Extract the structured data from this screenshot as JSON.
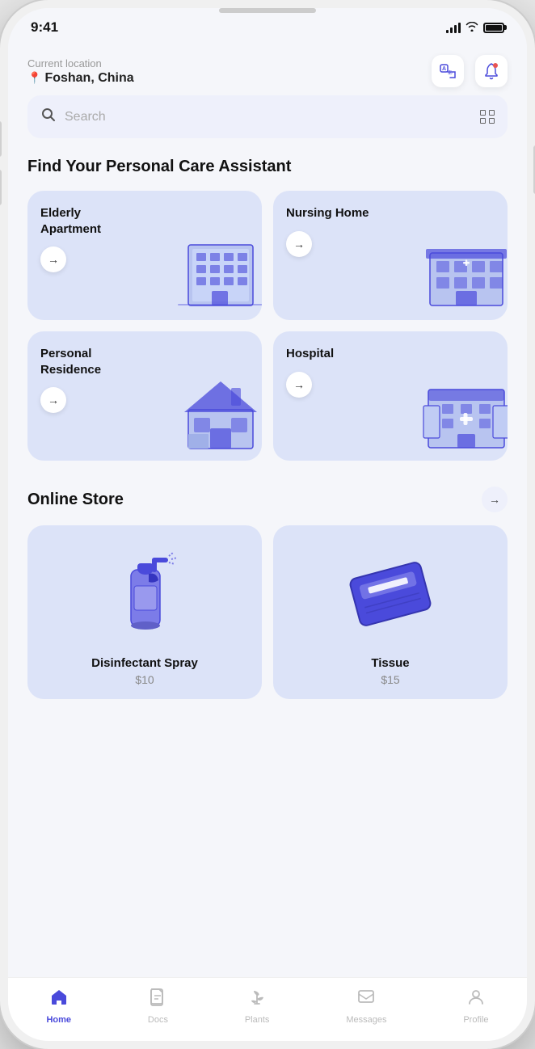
{
  "statusBar": {
    "time": "9:41"
  },
  "header": {
    "locationLabel": "Current location",
    "locationValue": "Foshan, China"
  },
  "search": {
    "placeholder": "Search"
  },
  "careSection": {
    "title": "Find Your Personal Care Assistant",
    "cards": [
      {
        "id": "elderly-apartment",
        "title": "Elderly Apartment",
        "type": "apartment"
      },
      {
        "id": "nursing-home",
        "title": "Nursing Home",
        "type": "nursing"
      },
      {
        "id": "personal-residence",
        "title": "Personal Residence",
        "type": "house"
      },
      {
        "id": "hospital",
        "title": "Hospital",
        "type": "hospital"
      }
    ]
  },
  "storeSection": {
    "title": "Online Store",
    "products": [
      {
        "id": "disinfectant-spray",
        "name": "Disinfectant Spray",
        "price": "$10",
        "type": "spray"
      },
      {
        "id": "tissue",
        "name": "Tissue",
        "price": "$15",
        "type": "tissue"
      }
    ]
  },
  "bottomNav": {
    "items": [
      {
        "id": "home",
        "label": "Home",
        "active": true
      },
      {
        "id": "documents",
        "label": "Documents",
        "active": false
      },
      {
        "id": "plant",
        "label": "Plants",
        "active": false
      },
      {
        "id": "messages",
        "label": "Messages",
        "active": false
      },
      {
        "id": "profile",
        "label": "Profile",
        "active": false
      }
    ]
  }
}
